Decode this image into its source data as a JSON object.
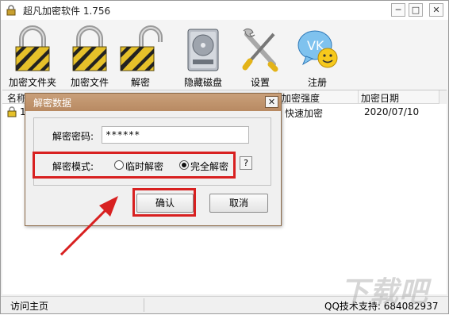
{
  "window": {
    "title": "超凡加密软件 1.756",
    "minimize_glyph": "─",
    "maximize_glyph": "□",
    "close_glyph": "✕"
  },
  "toolbar": {
    "items": [
      {
        "label": "加密文件夹",
        "icon": "lock-icon"
      },
      {
        "label": "加密文件",
        "icon": "lock-icon"
      },
      {
        "label": "解密",
        "icon": "open-lock-icon"
      },
      {
        "label": "隐藏磁盘",
        "icon": "hard-disk-icon"
      },
      {
        "label": "设置",
        "icon": "tools-icon"
      },
      {
        "label": "注册",
        "icon": "chat-smiley-icon"
      }
    ]
  },
  "list": {
    "columns": [
      "名称",
      "加密强度",
      "加密日期"
    ],
    "rows": [
      {
        "name": "1",
        "strength": "快速加密",
        "date": "2020/07/10"
      }
    ]
  },
  "dialog": {
    "title": "解密数据",
    "close_glyph": "✕",
    "password_label": "解密密码:",
    "password_value": "******",
    "mode_label": "解密模式:",
    "mode_options": [
      "临时解密",
      "完全解密"
    ],
    "mode_selected": "完全解密",
    "help_label": "?",
    "ok_label": "确认",
    "cancel_label": "取消"
  },
  "statusbar": {
    "left_link": "访问主页",
    "qq_support": "QQ技术支持: 684082937"
  },
  "watermark": "下载吧",
  "colors": {
    "highlight": "#d82020",
    "dialog_title": "#b88a62"
  }
}
